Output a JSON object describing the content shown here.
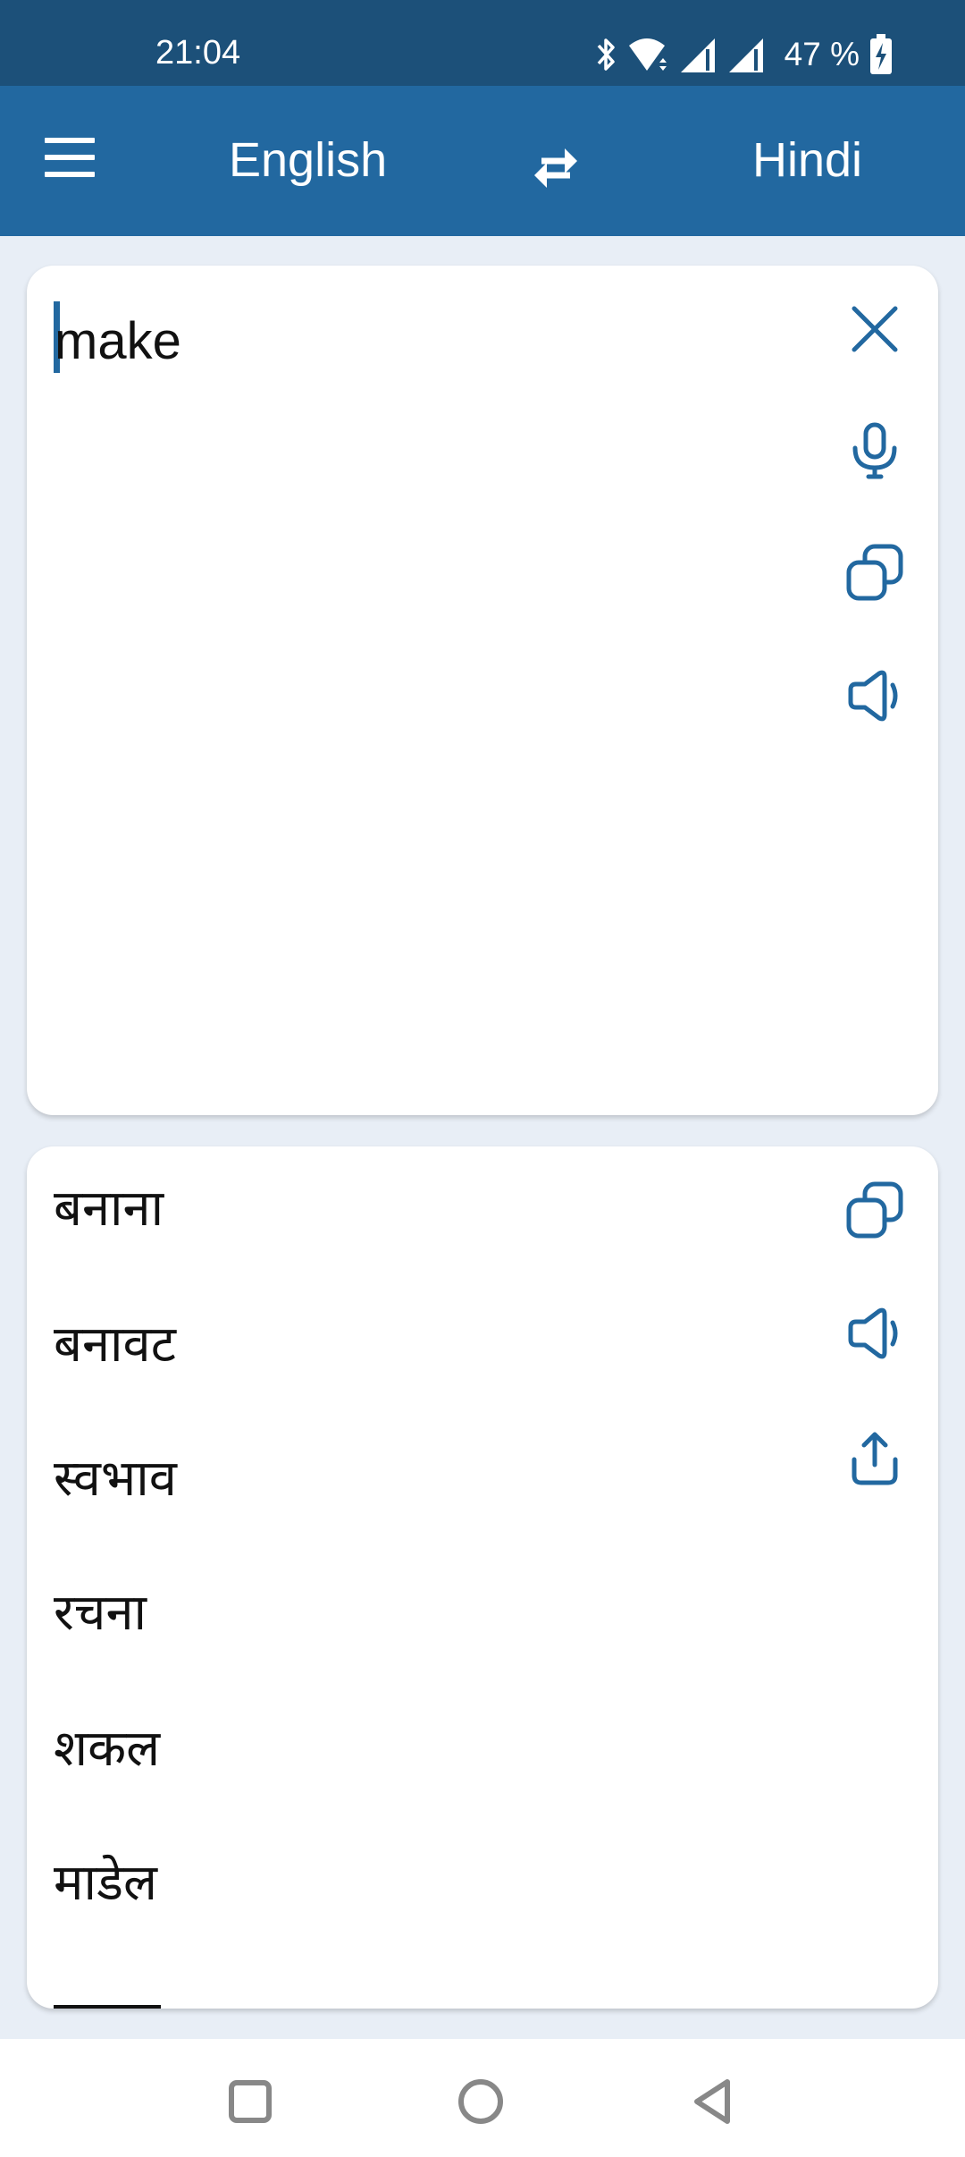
{
  "status_bar": {
    "time": "21:04",
    "battery_percent": "47 %",
    "icons": [
      "bluetooth-icon",
      "wifi-icon",
      "signal-icon",
      "signal-icon",
      "battery-charging-icon"
    ]
  },
  "app_bar": {
    "menu_icon": "menu-icon",
    "source_language": "English",
    "swap_icon": "swap-icon",
    "target_language": "Hindi"
  },
  "input_card": {
    "text": "make",
    "actions": [
      {
        "name": "clear",
        "icon": "close-icon"
      },
      {
        "name": "voice-input",
        "icon": "microphone-icon"
      },
      {
        "name": "copy",
        "icon": "copy-icon"
      },
      {
        "name": "speak",
        "icon": "speaker-icon"
      }
    ]
  },
  "output_card": {
    "translations": [
      "बनाना",
      "बनावट",
      "स्वभाव",
      "रचना",
      "शकल",
      "माडेल"
    ],
    "actions": [
      {
        "name": "copy",
        "icon": "copy-icon"
      },
      {
        "name": "speak",
        "icon": "speaker-icon"
      },
      {
        "name": "share",
        "icon": "share-icon"
      }
    ]
  },
  "nav_bar": {
    "buttons": [
      "recents",
      "home",
      "back"
    ]
  },
  "colors": {
    "status_bar": "#1c5079",
    "app_bar": "#2268a0",
    "accent": "#2268a0",
    "background": "#e8eef6"
  }
}
